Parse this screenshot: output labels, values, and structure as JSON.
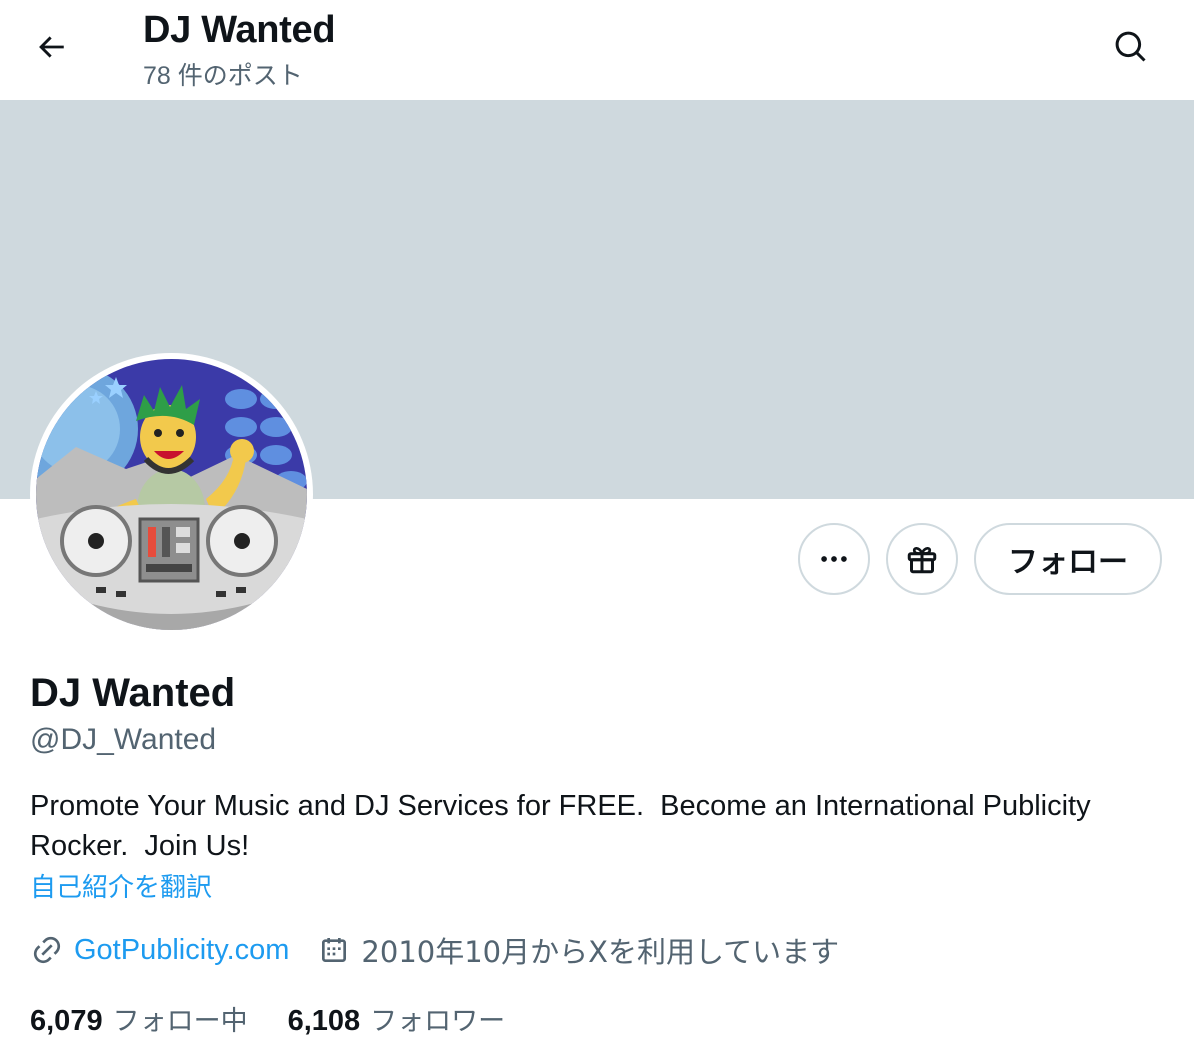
{
  "header": {
    "title": "DJ Wanted",
    "post_count": "78 件のポスト"
  },
  "actions": {
    "follow_label": "フォロー"
  },
  "profile": {
    "display_name": "DJ Wanted",
    "handle": "@DJ_Wanted",
    "bio_line1": "Promote Your Music and DJ Services for FREE.  Become an International Publicity",
    "bio_line2": "Rocker.  Join Us!",
    "translate_label": "自己紹介を翻訳",
    "website": "GotPublicity.com",
    "joined": "2010年10月からXを利用しています"
  },
  "stats": {
    "following_count": "6,079",
    "following_label": "フォロー中",
    "followers_count": "6,108",
    "followers_label": "フォロワー"
  },
  "icons": [
    "back-arrow-icon",
    "search-icon",
    "more-icon",
    "gift-icon",
    "link-icon",
    "calendar-icon"
  ],
  "colors": {
    "banner": "#cfd9de",
    "accent": "#1d9bf0",
    "secondary_text": "#536471",
    "primary_text": "#0f1419"
  }
}
